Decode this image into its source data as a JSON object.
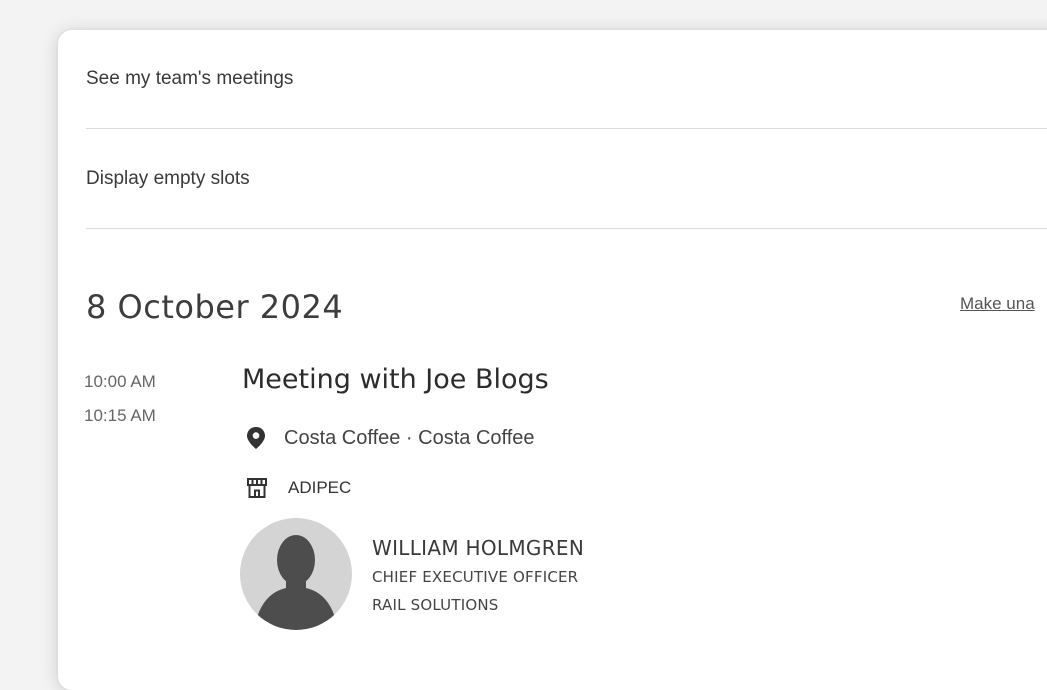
{
  "options": {
    "team_meetings_label": "See my team's meetings",
    "empty_slots_label": "Display empty slots"
  },
  "day": {
    "date": "8 October 2024",
    "action_link": "Make una"
  },
  "meeting": {
    "start_time": "10:00 AM",
    "end_time": "10:15 AM",
    "title": "Meeting with Joe Blogs",
    "location": "Costa Coffee · Costa Coffee",
    "event": "ADIPEC",
    "icons": {
      "location": "map-pin-icon",
      "event": "storefront-icon"
    },
    "attendee": {
      "name": "WILLIAM HOLMGREN",
      "role": "CHIEF EXECUTIVE OFFICER",
      "company": "RAIL SOLUTIONS"
    }
  },
  "colors": {
    "card_background": "#ffffff",
    "page_background": "#f3f3f3",
    "divider": "#dcdcdc",
    "avatar_background": "#d4d4d4",
    "avatar_silhouette": "#4d4d4d"
  }
}
